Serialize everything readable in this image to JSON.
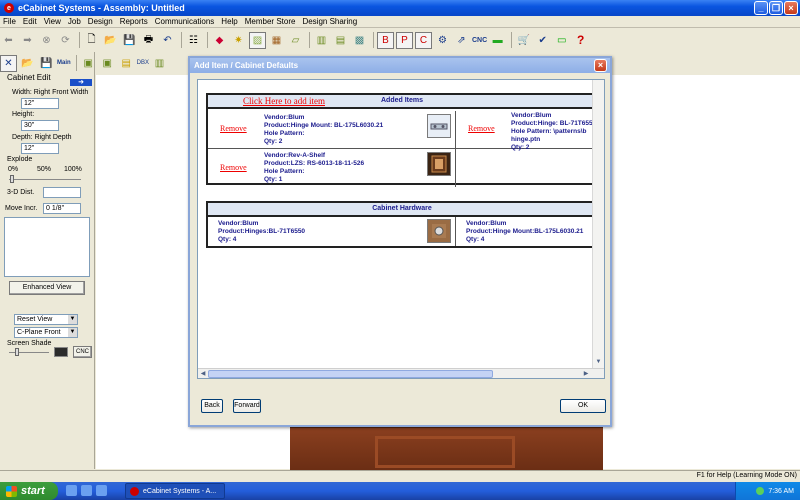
{
  "window": {
    "title": "eCabinet Systems - Assembly: Untitled",
    "minimize": "_",
    "restore": "❐",
    "close": "×"
  },
  "menu": [
    "File",
    "Edit",
    "View",
    "Job",
    "Design",
    "Reports",
    "Communications",
    "Help",
    "Member Store",
    "Design Sharing"
  ],
  "toolbar": {
    "cnc_label": "CNC",
    "main_label": "Main",
    "dbx_label": "DBX"
  },
  "left_panel": {
    "cabinet_edit": "Cabinet Edit",
    "width_label": "Width: Right Front Width",
    "width_value": "12\"",
    "height_label": "Height:",
    "height_value": "30\"",
    "depth_label": "Depth: Right Depth",
    "depth_value": "12\"",
    "explode_label": "Explode",
    "explode_ticks": [
      "0%",
      "50%",
      "100%"
    ],
    "dist_label": "3-D Dist.",
    "dist_value": "",
    "move_label": "Move Incr.",
    "move_value": "0 1/8\"",
    "enhanced_view": "Enhanced View",
    "reset_view": "Reset View",
    "cplane": "C-Plane Front",
    "screen_shade": "Screen Shade",
    "cnc_button": "CNC"
  },
  "dialog": {
    "title": "Add Item / Cabinet Defaults",
    "close": "×",
    "add_link": "Click Here to add item",
    "added_title": "Added Items",
    "hardware_title": "Cabinet Hardware",
    "remove_label": "Remove",
    "added_items": [
      {
        "vendor": "Vendor:Blum",
        "product": "Product:Hinge Mount: BL-175L6030.21",
        "hole": "Hole Pattern:",
        "qty": "Qty: 2"
      },
      {
        "vendor": "Vendor:Blum",
        "product": "Product:Hinge: BL-71T6550",
        "hole": "Hole Pattern: \\patterns\\b",
        "hole2": "hinge.ptn",
        "qty": "Qty: 2"
      },
      {
        "vendor": "Vendor:Rev-A-Shelf",
        "product": "Product:LZS: RS-6013-18-11-526",
        "hole": "Hole Pattern:",
        "qty": "Qty: 1"
      }
    ],
    "hardware_items": [
      {
        "vendor": "Vendor:Blum",
        "product": "Product:Hinges:BL-71T6550",
        "qty": "Qty: 4"
      },
      {
        "vendor": "Vendor:Blum",
        "product": "Product:Hinge Mount:BL-175L6030.21",
        "qty": "Qty: 4"
      }
    ],
    "back_button": "Back",
    "forward_button": "Forward",
    "ok_button": "OK"
  },
  "status": {
    "help": "F1 for Help (Learning Mode ON)"
  },
  "taskbar": {
    "start": "start",
    "task_label": "eCabinet Systems - A...",
    "clock": "7:36 AM"
  }
}
